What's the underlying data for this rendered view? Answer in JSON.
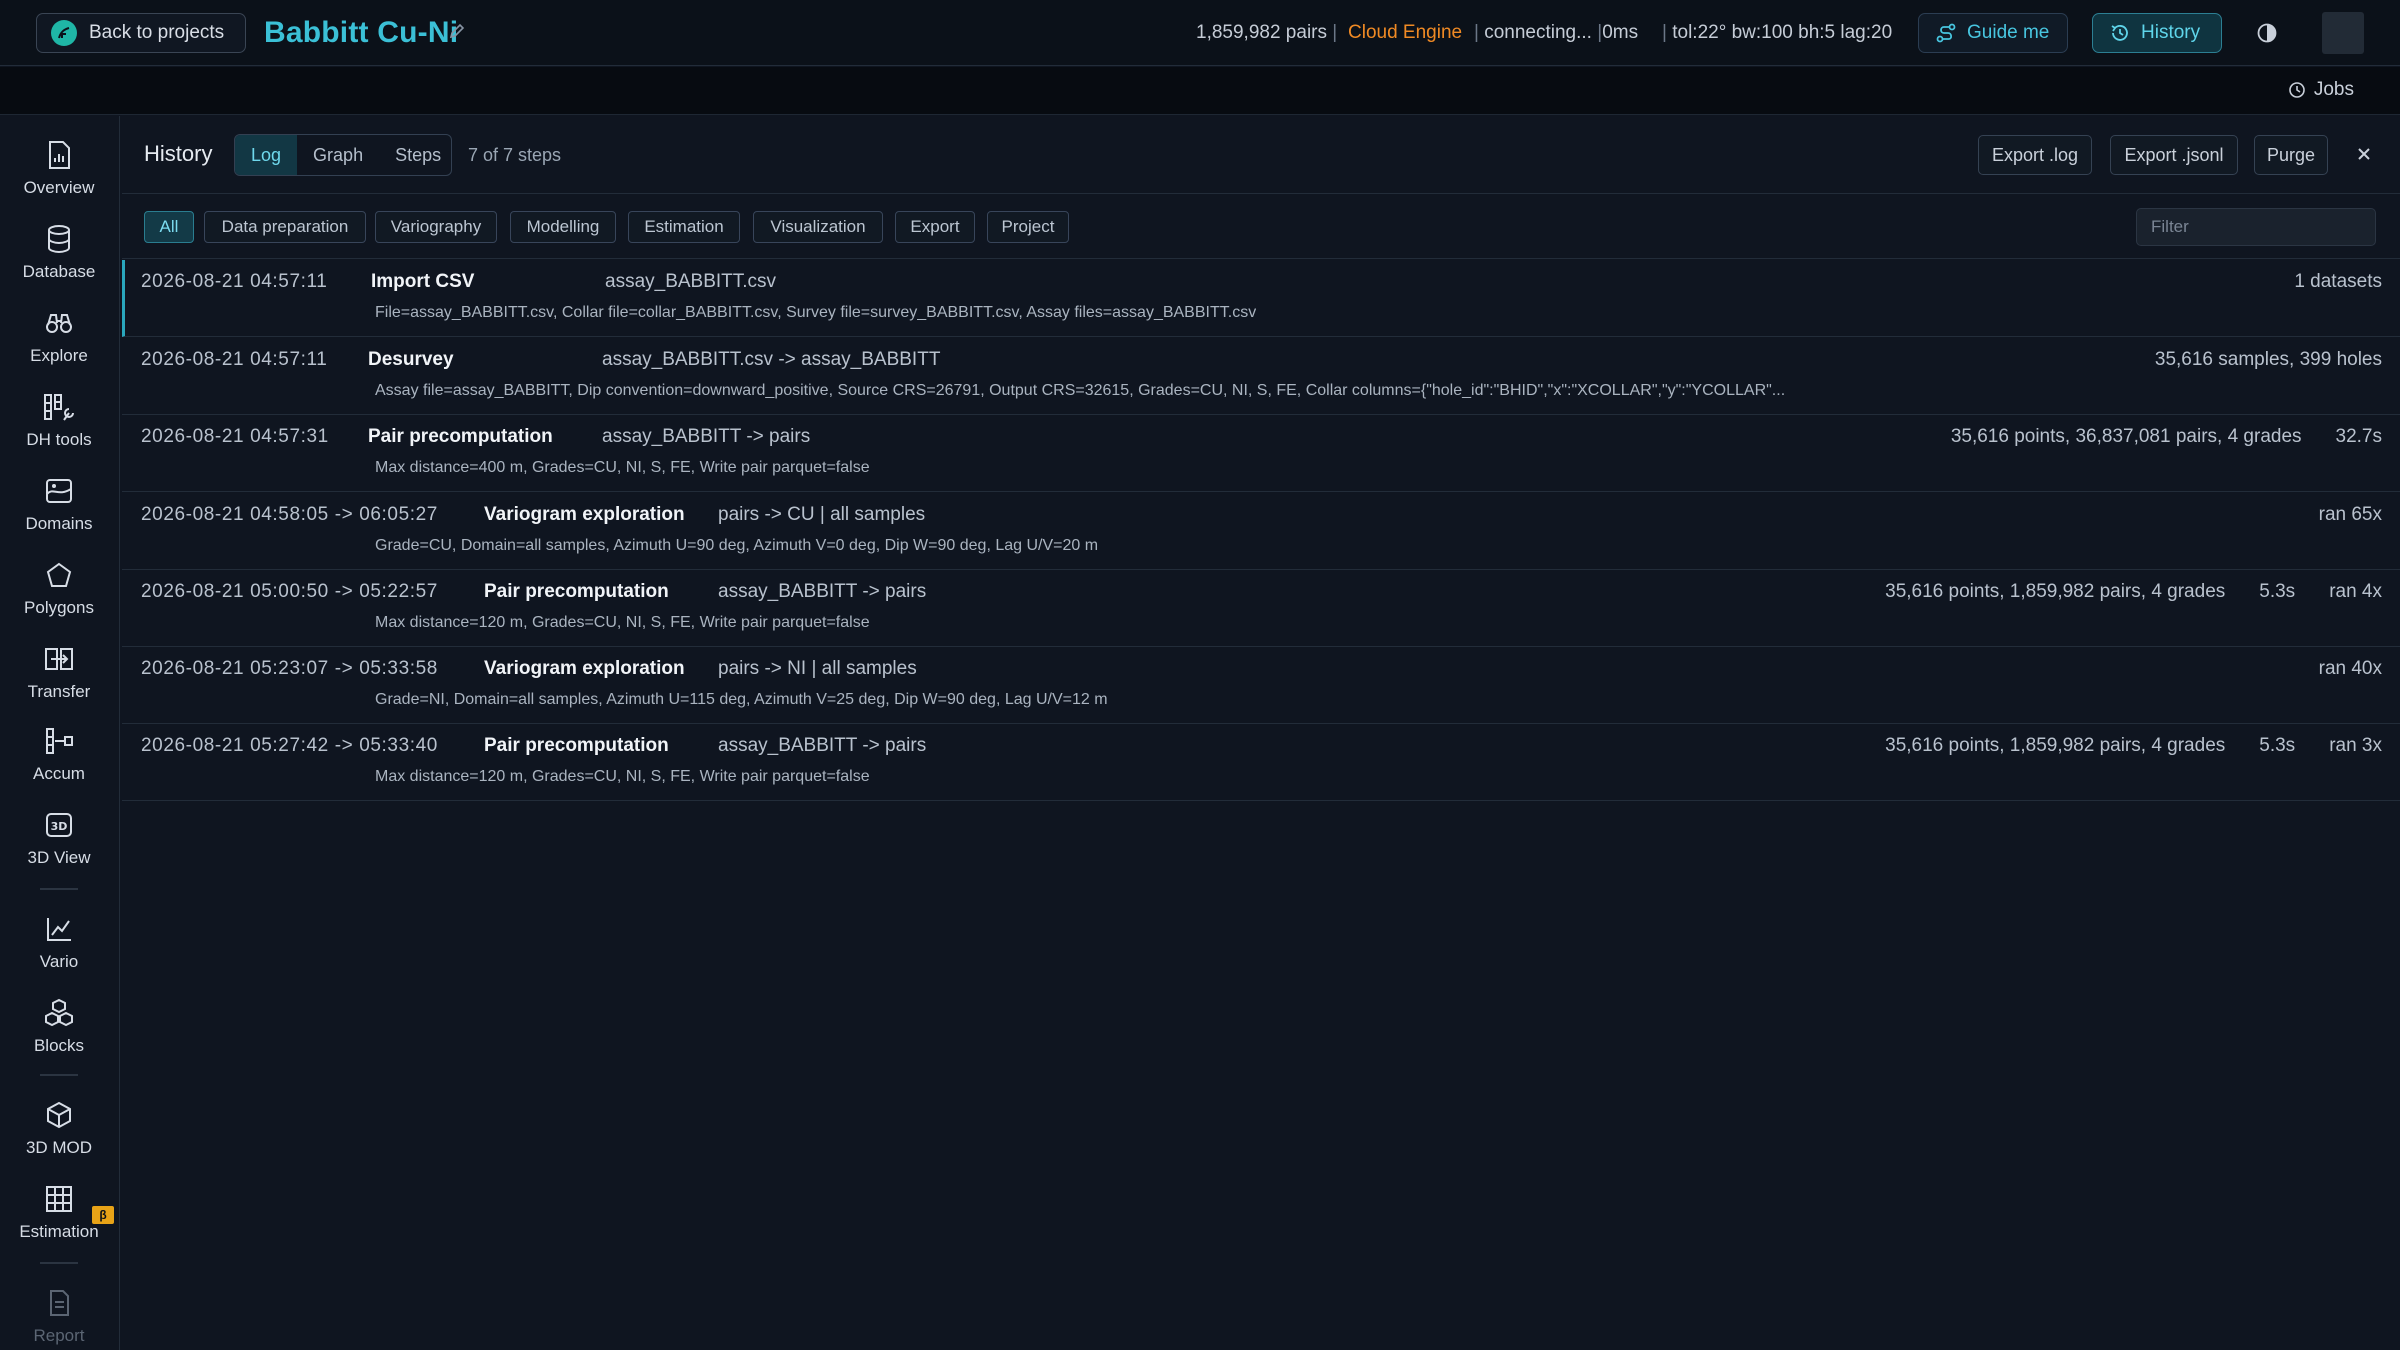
{
  "topbar": {
    "back_label": "Back to projects",
    "project_title": "Babbitt Cu-Ni",
    "pairs": "1,859,982 pairs",
    "engine": "Cloud Engine",
    "connecting": "connecting...",
    "latency": "0ms",
    "params": "tol:22° bw:100 bh:5 lag:20",
    "guide_label": "Guide me",
    "history_label": "History",
    "accent": "#3bc0d6",
    "engine_color": "#f08a24"
  },
  "jobs_label": "Jobs",
  "sidebar": {
    "items": [
      {
        "label": "Overview",
        "icon": "overview-icon"
      },
      {
        "label": "Database",
        "icon": "database-icon"
      },
      {
        "label": "Explore",
        "icon": "binoculars-icon"
      },
      {
        "label": "DH tools",
        "icon": "dh-tools-icon"
      },
      {
        "label": "Domains",
        "icon": "domains-icon"
      },
      {
        "label": "Polygons",
        "icon": "polygon-icon"
      },
      {
        "label": "Transfer",
        "icon": "transfer-icon"
      },
      {
        "label": "Accum",
        "icon": "accum-icon"
      },
      {
        "label": "3D View",
        "icon": "3d-view-icon"
      },
      {
        "label": "Vario",
        "icon": "chart-icon"
      },
      {
        "label": "Blocks",
        "icon": "blocks-icon"
      },
      {
        "label": "3D MOD",
        "icon": "cube-icon"
      },
      {
        "label": "Estimation",
        "icon": "grid-icon"
      },
      {
        "label": "Report",
        "icon": "report-icon"
      }
    ],
    "beta_badge": "β"
  },
  "history": {
    "title": "History",
    "tabs": [
      "Log",
      "Graph",
      "Steps"
    ],
    "active_tab": "Log",
    "steps_count": "7 of 7 steps",
    "export_log": "Export .log",
    "export_jsonl": "Export .jsonl",
    "purge": "Purge",
    "filters": [
      "All",
      "Data preparation",
      "Variography",
      "Modelling",
      "Estimation",
      "Visualization",
      "Export",
      "Project"
    ],
    "filter_placeholder": "Filter",
    "rows": [
      {
        "time": "2026-08-21 04:57:11",
        "op": "Import CSV",
        "target": "assay_BABBITT.csv",
        "detail": "File=assay_BABBITT.csv, Collar file=collar_BABBITT.csv, Survey file=survey_BABBITT.csv, Assay files=assay_BABBITT.csv",
        "right": [
          "1 datasets"
        ]
      },
      {
        "time": "2026-08-21 04:57:11",
        "op": "Desurvey",
        "target": "assay_BABBITT.csv -> assay_BABBITT",
        "detail": "Assay file=assay_BABBITT, Dip convention=downward_positive, Source CRS=26791, Output CRS=32615, Grades=CU, NI, S, FE, Collar columns={\"hole_id\":\"BHID\",\"x\":\"XCOLLAR\",\"y\":\"YCOLLAR\"...",
        "right": [
          "35,616 samples, 399 holes"
        ]
      },
      {
        "time": "2026-08-21 04:57:31",
        "op": "Pair precomputation",
        "target": "assay_BABBITT -> pairs",
        "detail": "Max distance=400 m, Grades=CU, NI, S, FE, Write pair parquet=false",
        "right": [
          "35,616 points, 36,837,081 pairs, 4 grades",
          "32.7s"
        ]
      },
      {
        "time": "2026-08-21 04:58:05 -> 06:05:27",
        "op": "Variogram exploration",
        "target": "pairs -> CU | all samples",
        "detail": "Grade=CU, Domain=all samples, Azimuth U=90 deg, Azimuth V=0 deg, Dip W=90 deg, Lag U/V=20 m",
        "right": [
          "ran 65x"
        ]
      },
      {
        "time": "2026-08-21 05:00:50 -> 05:22:57",
        "op": "Pair precomputation",
        "target": "assay_BABBITT -> pairs",
        "detail": "Max distance=120 m, Grades=CU, NI, S, FE, Write pair parquet=false",
        "right": [
          "35,616 points, 1,859,982 pairs, 4 grades",
          "5.3s",
          "ran 4x"
        ]
      },
      {
        "time": "2026-08-21 05:23:07 -> 05:33:58",
        "op": "Variogram exploration",
        "target": "pairs -> NI | all samples",
        "detail": "Grade=NI, Domain=all samples, Azimuth U=115 deg, Azimuth V=25 deg, Dip W=90 deg, Lag U/V=12 m",
        "right": [
          "ran 40x"
        ]
      },
      {
        "time": "2026-08-21 05:27:42 -> 05:33:40",
        "op": "Pair precomputation",
        "target": "assay_BABBITT -> pairs",
        "detail": "Max distance=120 m, Grades=CU, NI, S, FE, Write pair parquet=false",
        "right": [
          "35,616 points, 1,859,982 pairs, 4 grades",
          "5.3s",
          "ran 3x"
        ]
      }
    ]
  }
}
